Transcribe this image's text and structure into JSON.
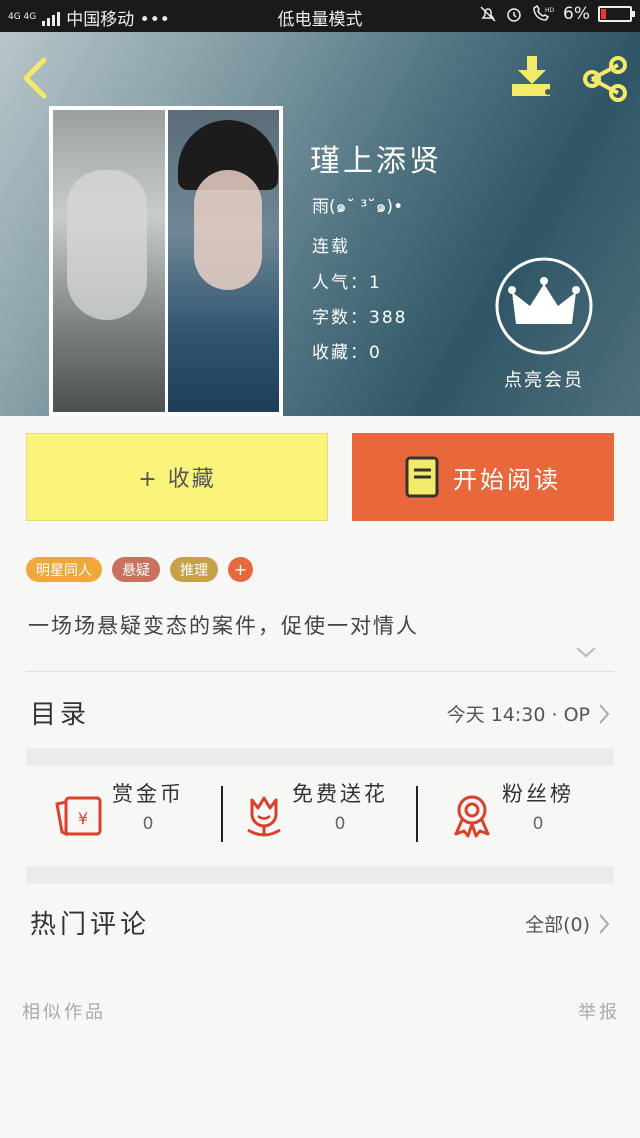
{
  "status_bar": {
    "network": "4G 4G",
    "carrier": "中国移动 •••",
    "mode": "低电量模式",
    "battery": "6%"
  },
  "book": {
    "title": "瑾上添贤",
    "author": "雨(๑˘ ³˘๑)•",
    "status": "连载",
    "popularity_label": "人气：",
    "popularity": "1",
    "words_label": "字数：",
    "words": "388",
    "favorites_label": "收藏：",
    "favorites": "0",
    "description": "一场场悬疑变态的案件，促使一对情人"
  },
  "vip": {
    "label": "点亮会员"
  },
  "actions": {
    "collect": "+ 收藏",
    "read": "开始阅读"
  },
  "tags": [
    {
      "label": "明星同人",
      "color": "#f0a83a"
    },
    {
      "label": "悬疑",
      "color": "#c9735e"
    },
    {
      "label": "推理",
      "color": "#c9a04a"
    }
  ],
  "tag_add": "+",
  "catalog": {
    "title": "目录",
    "updated": "今天 14:30 · OP"
  },
  "stats": [
    {
      "label": "赏金币",
      "value": "0",
      "icon": "red-envelope-icon"
    },
    {
      "label": "免费送花",
      "value": "0",
      "icon": "flower-icon"
    },
    {
      "label": "粉丝榜",
      "value": "0",
      "icon": "medal-icon"
    }
  ],
  "comments": {
    "title": "热门评论",
    "all": "全部(0)"
  },
  "footer": {
    "similar": "相似作品",
    "report": "举报"
  },
  "colors": {
    "accent_orange": "#e8683c",
    "collect_yellow": "#fbf47a",
    "icon_red": "#d9412b",
    "icon_yellow": "#f5e96a"
  }
}
